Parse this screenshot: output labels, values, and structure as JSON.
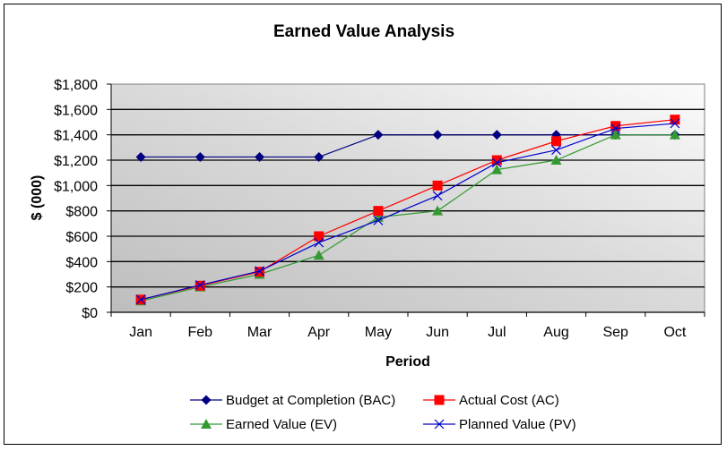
{
  "chart_data": {
    "type": "line",
    "title": "Earned Value Analysis",
    "xlabel": "Period",
    "ylabel": "$ (000)",
    "categories": [
      "Jan",
      "Feb",
      "Mar",
      "Apr",
      "May",
      "Jun",
      "Jul",
      "Aug",
      "Sep",
      "Oct"
    ],
    "ylim": [
      0,
      1800
    ],
    "ytick_step": 200,
    "ytick_labels": [
      "$0",
      "$200",
      "$400",
      "$600",
      "$800",
      "$1,000",
      "$1,200",
      "$1,400",
      "$1,600",
      "$1,800"
    ],
    "grid": true,
    "legend_position": "bottom",
    "series": [
      {
        "name": "Budget at Completion (BAC)",
        "color": "#000080",
        "marker": "diamond",
        "values": [
          1225,
          1225,
          1225,
          1225,
          1400,
          1400,
          1400,
          1400,
          1400,
          1400
        ]
      },
      {
        "name": "Actual Cost (AC)",
        "color": "#ff0000",
        "marker": "square",
        "values": [
          100,
          210,
          320,
          600,
          800,
          1000,
          1200,
          1350,
          1470,
          1520
        ]
      },
      {
        "name": "Earned Value (EV)",
        "color": "#339933",
        "marker": "triangle",
        "values": [
          90,
          200,
          300,
          450,
          750,
          800,
          1125,
          1200,
          1400,
          1400
        ]
      },
      {
        "name": "Planned Value (PV)",
        "color": "#0000cc",
        "marker": "x",
        "values": [
          100,
          215,
          325,
          550,
          725,
          920,
          1180,
          1280,
          1450,
          1490
        ]
      }
    ]
  }
}
